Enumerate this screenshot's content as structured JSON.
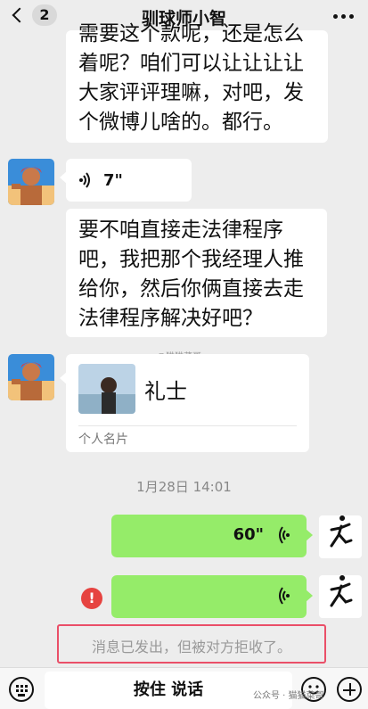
{
  "header": {
    "back_count": "2",
    "title": "驯球师小智",
    "more_icon": "more-dots-icon"
  },
  "messages": [
    {
      "side": "left",
      "type": "text",
      "lines": [
        "需要这个款呢，还是怎么",
        "着呢？咱们可以让让让让",
        "大家评评理嘛，对吧，发",
        "个微博儿啥的。都行。"
      ]
    },
    {
      "side": "left",
      "type": "voice",
      "duration": "7\""
    },
    {
      "side": "left",
      "type": "text",
      "lines": [
        "要不咱直接走法律程序",
        "吧，我把那个我经理人推",
        "给你，然后你俩直接去走",
        "法律程序解决好吧？"
      ]
    },
    {
      "side": "left",
      "type": "contact-card",
      "name": "礼士",
      "kind": "个人名片"
    }
  ],
  "watermark_mid": "@猫猫菜哥",
  "timestamp": "1月28日 14:01",
  "outgoing": [
    {
      "duration": "60\"",
      "failed": false
    },
    {
      "duration": "",
      "failed": true,
      "error_mark": "!"
    }
  ],
  "system_notice": "消息已发出，但被对方拒收了。",
  "input_bar": {
    "hold_to_talk": "按住 说话",
    "icons": [
      "keyboard-icon",
      "emoji-icon",
      "plus-icon"
    ]
  },
  "watermark_bottom": "公众号 · 猫猫菜哥",
  "colors": {
    "background": "#ededed",
    "bubble_in": "#ffffff",
    "bubble_out": "#95ec69",
    "error": "#e64340",
    "highlight_box": "#ea4f68"
  }
}
